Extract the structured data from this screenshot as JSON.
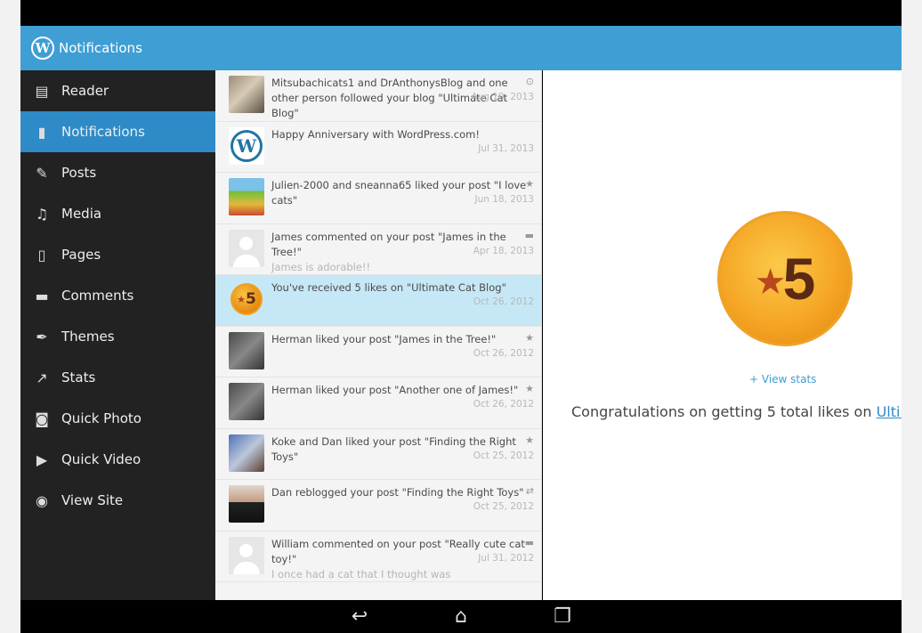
{
  "actionbar": {
    "title": "Notifications"
  },
  "sidebar": {
    "items": [
      {
        "label": "Reader",
        "icon": "reader-icon"
      },
      {
        "label": "Notifications",
        "icon": "notifications-icon"
      },
      {
        "label": "Posts",
        "icon": "pin-icon"
      },
      {
        "label": "Media",
        "icon": "media-icon"
      },
      {
        "label": "Pages",
        "icon": "pages-icon"
      },
      {
        "label": "Comments",
        "icon": "comments-icon"
      },
      {
        "label": "Themes",
        "icon": "themes-icon"
      },
      {
        "label": "Stats",
        "icon": "stats-icon"
      },
      {
        "label": "Quick Photo",
        "icon": "camera-icon"
      },
      {
        "label": "Quick Video",
        "icon": "video-icon"
      },
      {
        "label": "View Site",
        "icon": "eye-icon"
      }
    ]
  },
  "notifications": [
    {
      "text": "Mitsubachicats1 and DrAnthonysBlog and one other person followed your blog \"Ultimate Cat Blog\"",
      "sub": "",
      "date": "Aug 10, 2013",
      "meta_icon": "follow-icon"
    },
    {
      "text": "Happy Anniversary with WordPress.com!",
      "sub": "",
      "date": "Jul 31, 2013",
      "meta_icon": ""
    },
    {
      "text": "Julien-2000 and sneanna65 liked your post \"I love cats\"",
      "sub": "",
      "date": "Jun 18, 2013",
      "meta_icon": "star-icon"
    },
    {
      "text": "James commented on your post \"James in the Tree!\"",
      "sub": "James is adorable!!",
      "date": "Apr 18, 2013",
      "meta_icon": "comment-icon"
    },
    {
      "text": "You've received 5 likes on \"Ultimate Cat Blog\"",
      "sub": "",
      "date": "Oct 26, 2012",
      "meta_icon": ""
    },
    {
      "text": "Herman liked your post \"James in the Tree!\"",
      "sub": "",
      "date": "Oct 26, 2012",
      "meta_icon": "star-icon"
    },
    {
      "text": "Herman liked your post \"Another one of James!\"",
      "sub": "",
      "date": "Oct 26, 2012",
      "meta_icon": "star-icon"
    },
    {
      "text": "Koke and Dan liked your post \"Finding the Right Toys\"",
      "sub": "",
      "date": "Oct 25, 2012",
      "meta_icon": "star-icon"
    },
    {
      "text": "Dan reblogged your post \"Finding the Right Toys\"",
      "sub": "",
      "date": "Oct 25, 2012",
      "meta_icon": "reblog-icon"
    },
    {
      "text": "William commented on your post \"Really cute cat toy!\"",
      "sub": "I once had a cat that I thought was",
      "date": "Jul 31, 2012",
      "meta_icon": "comment-icon"
    }
  ],
  "badge_small": {
    "star": "★",
    "number": "5"
  },
  "detail": {
    "badge_star": "★",
    "badge_number": "5",
    "view_stats": "+ View stats",
    "congrats_text": "Congratulations on getting 5 total likes on ",
    "congrats_link": "Ultim"
  },
  "colors": {
    "actionbar": "#3f9ed3",
    "sidebar": "#222222",
    "active": "#2e8bc7",
    "selected_row": "#c6e8f6",
    "badge": "#f5a624"
  }
}
